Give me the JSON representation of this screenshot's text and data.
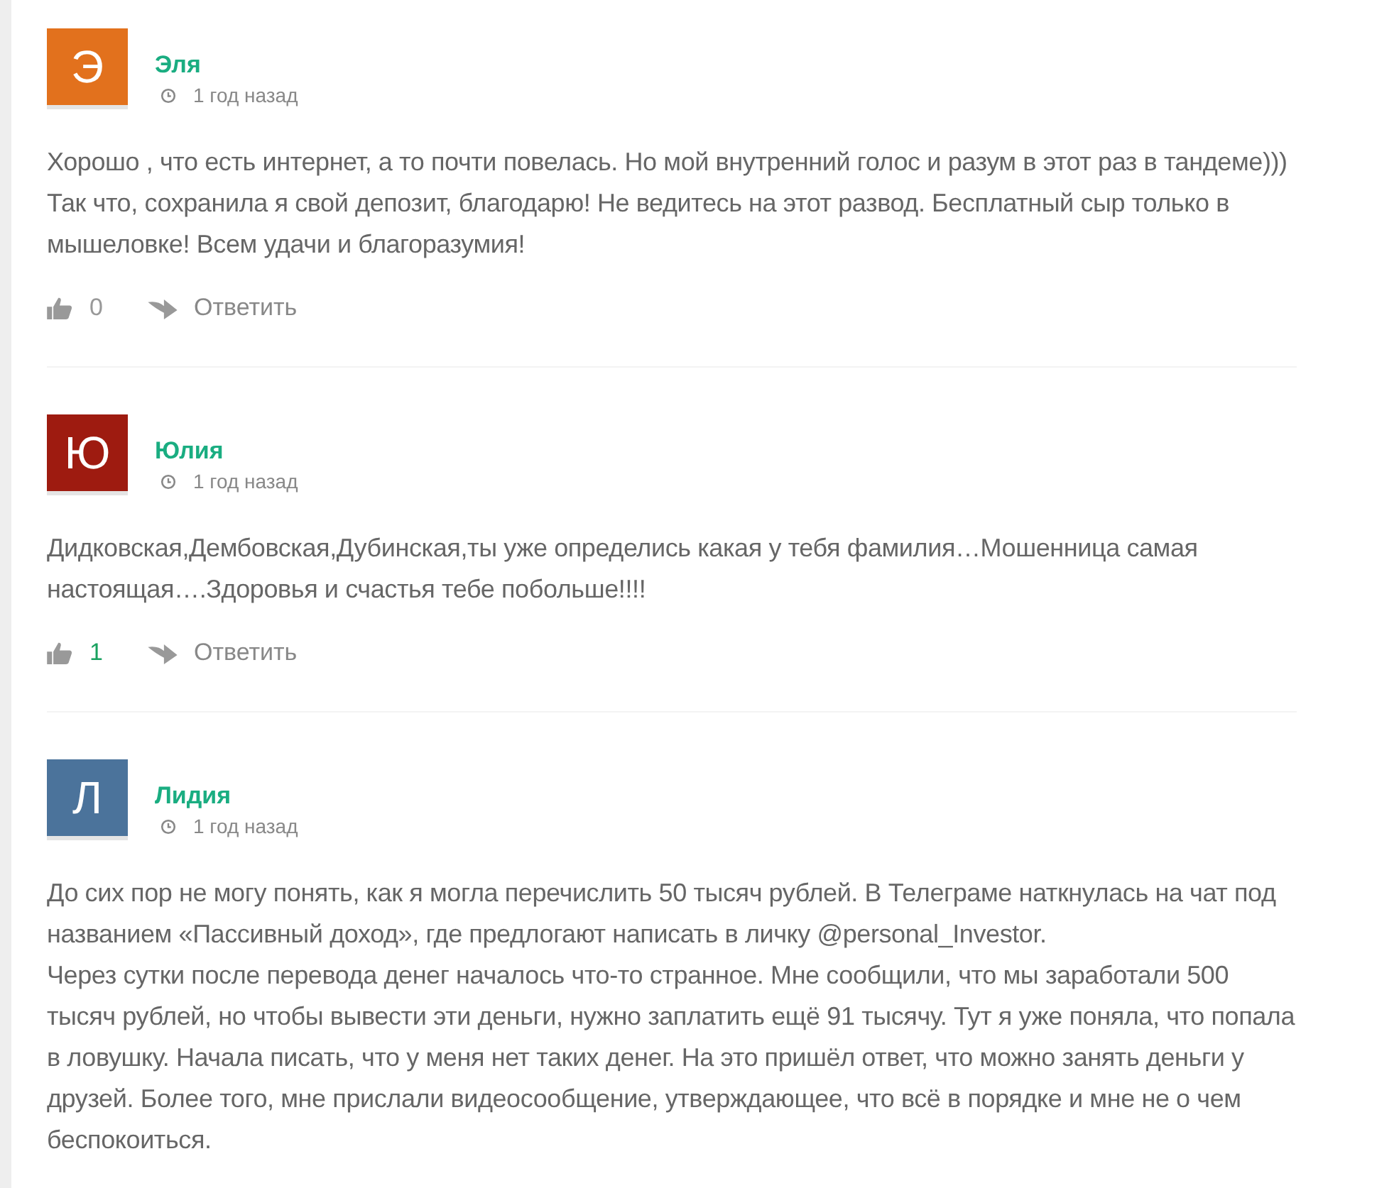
{
  "comments": [
    {
      "initial": "Э",
      "color": "#e2711d",
      "author": "Эля",
      "time": "1 год назад",
      "paragraphs": [
        "Хорошо , что есть интернет, а то почти повелась. Но мой внутренний голос и разум в этот раз в тандеме))) Так что, сохранила я свой депозит, благодарю! Не ведитесь на этот развод. Бесплатный сыр только в мышеловке! Всем удачи и благоразумия!"
      ],
      "actions": {
        "likes": "0",
        "highlighted": false,
        "reply": "Ответить"
      }
    },
    {
      "initial": "Ю",
      "color": "#9e1b10",
      "author": "Юлия",
      "time": "1 год назад",
      "paragraphs": [
        "Дидковская,Дембовская,Дубинская,ты уже определись какая у тебя фамилия…Мошенница самая настоящая….Здоровья и счастья тебе побольше!!!!"
      ],
      "actions": {
        "likes": "1",
        "highlighted": true,
        "reply": "Ответить"
      }
    },
    {
      "initial": "Л",
      "color": "#4b739b",
      "author": "Лидия",
      "time": "1 год назад",
      "paragraphs": [
        "До сих пор не могу понять, как я могла перечислить 50 тысяч рублей. В Телеграме наткнулась на чат под названием «Пассивный доход», где предлогают написать в личку @personal_Investor.",
        "Через сутки после перевода денег началось что-то странное. Мне сообщили, что мы заработали 500 тысяч рублей, но чтобы вывести эти деньги, нужно заплатить ещё 91 тысячу. Тут я уже поняла, что попала в ловушку. Начала писать, что у меня нет таких денег. На это пришёл ответ, что можно занять деньги у друзей. Более того, мне прислали видеосообщение, утверждающее, что всё в порядке и мне не о чем беспокоиться."
      ]
    }
  ]
}
